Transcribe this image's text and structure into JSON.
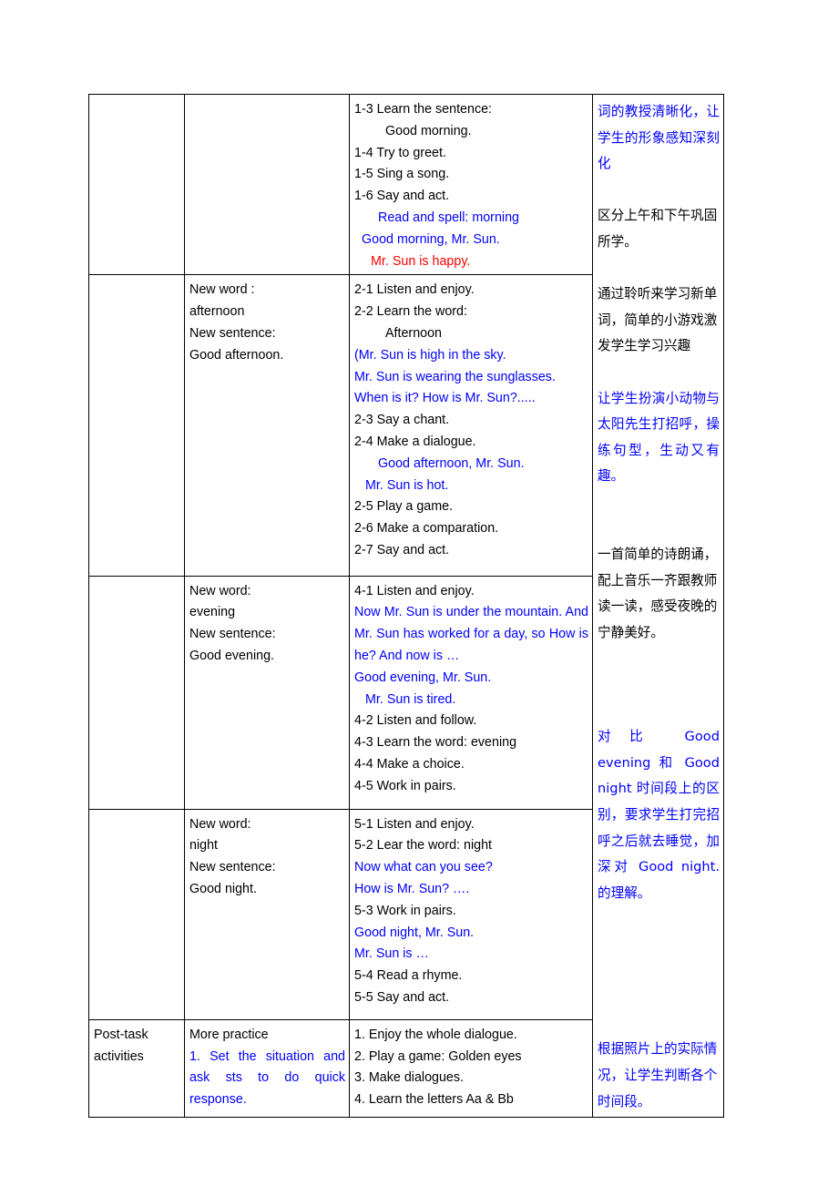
{
  "document": {
    "type": "lesson-plan-table",
    "colors": {
      "blue": "#0000ff",
      "red": "#ff0000",
      "black": "#000000"
    }
  },
  "rows": [
    {
      "stage": "",
      "new_language": "",
      "procedure": {
        "lines": [
          {
            "text": "1-3 Learn the sentence:",
            "color": "black",
            "indent": 0
          },
          {
            "text": "Good morning.",
            "color": "black",
            "indent": 1
          },
          {
            "text": "1-4 Try to greet.",
            "color": "black",
            "indent": 0
          },
          {
            "text": "1-5 Sing a song.",
            "color": "black",
            "indent": 0
          },
          {
            "text": "1-6 Say and act.",
            "color": "black",
            "indent": 0
          },
          {
            "text": "Read and spell: morning",
            "color": "blue",
            "indent": 2
          },
          {
            "text": "Good morning, Mr. Sun.",
            "color": "blue",
            "indent": 3
          },
          {
            "text": "Mr. Sun is happy.",
            "color": "red",
            "indent": 4
          }
        ]
      }
    },
    {
      "stage": "",
      "new_language": {
        "lines": [
          {
            "text": "New word :",
            "color": "black"
          },
          {
            "text": "afternoon",
            "color": "black"
          },
          {
            "text": "New sentence:",
            "color": "black"
          },
          {
            "text": "Good afternoon.",
            "color": "black"
          }
        ]
      },
      "procedure": {
        "lines": [
          {
            "text": "2-1 Listen and enjoy.",
            "color": "black",
            "indent": 0
          },
          {
            "text": "2-2 Learn the word:",
            "color": "black",
            "indent": 0
          },
          {
            "text": "Afternoon",
            "color": "black",
            "indent": 1
          },
          {
            "text": "(Mr. Sun is high in the sky.",
            "color": "blue",
            "indent": 0
          },
          {
            "text": "Mr. Sun is wearing the sunglasses.",
            "color": "blue",
            "indent": 0
          },
          {
            "text": "When is it? How is Mr. Sun?.....",
            "color": "blue",
            "indent": 0
          },
          {
            "text": "2-3 Say a chant.",
            "color": "black",
            "indent": 0
          },
          {
            "text": "2-4 Make a dialogue.",
            "color": "black",
            "indent": 0
          },
          {
            "text": "Good afternoon, Mr. Sun.",
            "color": "blue",
            "indent": 2
          },
          {
            "text": "Mr. Sun is hot.",
            "color": "blue",
            "indent": 5
          },
          {
            "text": "2-5 Play a game.",
            "color": "black",
            "indent": 0
          },
          {
            "text": "2-6 Make a comparation.",
            "color": "black",
            "indent": 0
          },
          {
            "text": "2-7 Say and act.",
            "color": "black",
            "indent": 0
          }
        ]
      }
    },
    {
      "stage": "",
      "new_language": {
        "lines": [
          {
            "text": "New word:",
            "color": "black"
          },
          {
            "text": "evening",
            "color": "black"
          },
          {
            "text": "New sentence:",
            "color": "black"
          },
          {
            "text": "Good evening.",
            "color": "black"
          }
        ]
      },
      "procedure": {
        "lines": [
          {
            "text": "4-1 Listen and enjoy.",
            "color": "black",
            "indent": 0
          },
          {
            "text": "Now Mr. Sun is under the mountain. And Mr. Sun has worked for a day, so How is he? And now is …",
            "color": "blue",
            "indent": 0,
            "justify": true
          },
          {
            "text": "Good evening, Mr. Sun.",
            "color": "blue",
            "indent": 0
          },
          {
            "text": "Mr. Sun is tired.",
            "color": "blue",
            "indent": 5
          },
          {
            "text": "4-2 Listen and follow.",
            "color": "black",
            "indent": 0
          },
          {
            "text": "4-3 Learn the word: evening",
            "color": "black",
            "indent": 0
          },
          {
            "text": "4-4 Make a choice.",
            "color": "black",
            "indent": 0
          },
          {
            "text": "4-5 Work in pairs.",
            "color": "black",
            "indent": 0
          }
        ]
      }
    },
    {
      "stage": "",
      "new_language": {
        "lines": [
          {
            "text": "New word:",
            "color": "black"
          },
          {
            "text": "night",
            "color": "black"
          },
          {
            "text": "New sentence:",
            "color": "black"
          },
          {
            "text": "Good night.",
            "color": "black"
          }
        ]
      },
      "procedure": {
        "lines": [
          {
            "text": "5-1 Listen and enjoy.",
            "color": "black",
            "indent": 0
          },
          {
            "text": "5-2 Lear the word: night",
            "color": "black",
            "indent": 0
          },
          {
            "text": "Now what can you see?",
            "color": "blue",
            "indent": 0
          },
          {
            "text": "How is Mr. Sun? ….",
            "color": "blue",
            "indent": 0
          },
          {
            "text": "5-3 Work in pairs.",
            "color": "black",
            "indent": 0
          },
          {
            "text": "Good night, Mr. Sun.",
            "color": "blue",
            "indent": 0
          },
          {
            "text": "Mr. Sun is …",
            "color": "blue",
            "indent": 0
          },
          {
            "text": "5-4 Read a rhyme.",
            "color": "black",
            "indent": 0
          },
          {
            "text": "5-5 Say and act.",
            "color": "black",
            "indent": 0
          }
        ]
      }
    },
    {
      "stage": {
        "lines": [
          {
            "text": "Post-task",
            "color": "black"
          },
          {
            "text": "activities",
            "color": "black"
          }
        ]
      },
      "new_language": {
        "lines": [
          {
            "text": "More practice",
            "color": "black"
          },
          {
            "text": "1. Set the situation and ask sts to do quick response.",
            "color": "blue",
            "justify": true
          }
        ]
      },
      "procedure": {
        "lines": [
          {
            "text": "1. Enjoy the whole dialogue.",
            "color": "black",
            "indent": 0
          },
          {
            "text": "2. Play a game: Golden eyes",
            "color": "black",
            "indent": 0
          },
          {
            "text": "3. Make dialogues.",
            "color": "black",
            "indent": 0
          },
          {
            "text": "4. Learn the letters Aa & Bb",
            "color": "black",
            "indent": 0
          }
        ]
      }
    }
  ],
  "notes_column": {
    "blocks": [
      {
        "text": "词的教授清晰化，让学生的形象感知深刻化",
        "color": "blue",
        "justify": true
      },
      {
        "text": "",
        "color": "black",
        "spacer": true
      },
      {
        "text": "区分上午和下午巩固所学。",
        "color": "black",
        "justify": false
      },
      {
        "text": "",
        "color": "black",
        "spacer": true
      },
      {
        "text": "通过聆听来学习新单词，简单的小游戏激发学生学习兴趣",
        "color": "black",
        "justify": false
      },
      {
        "text": "",
        "color": "black",
        "spacer": true
      },
      {
        "text": "让学生扮演小动物与太阳先生打招呼，操练句型，生动又有趣。",
        "color": "blue",
        "justify": true
      },
      {
        "text": "",
        "color": "black",
        "spacer": true
      },
      {
        "text": "",
        "color": "black",
        "spacer": true
      },
      {
        "text": "一首简单的诗朗诵，配上音乐一齐跟教师读一读，感受夜晚的宁静美好。",
        "color": "black",
        "justify": false
      },
      {
        "text": "",
        "color": "black",
        "spacer": true
      },
      {
        "text": "",
        "color": "black",
        "spacer": true
      },
      {
        "text": "",
        "color": "black",
        "spacer": true
      },
      {
        "text": "对比 Good evening 和 Good night 时间段上的区别，要求学生打完招呼之后就去睡觉，加深对 Good night. 的理解。",
        "color": "blue",
        "justify": true
      },
      {
        "text": "",
        "color": "black",
        "spacer": true
      },
      {
        "text": "",
        "color": "black",
        "spacer": true
      },
      {
        "text": "",
        "color": "black",
        "spacer": true
      },
      {
        "text": "",
        "color": "black",
        "spacer": true
      },
      {
        "text": "",
        "color": "black",
        "spacer": true
      },
      {
        "text": "根据照片上的实际情况，让学生判断各个时间段。",
        "color": "blue",
        "justify": false
      }
    ]
  }
}
